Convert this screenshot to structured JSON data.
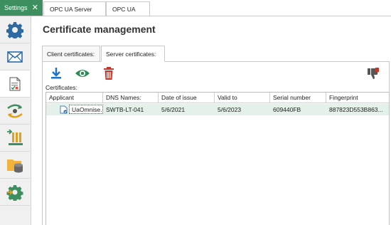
{
  "window_tabs": [
    {
      "label": "Settings",
      "close": "✕"
    },
    {
      "label": "OPC UA Server"
    },
    {
      "label": "OPC UA"
    }
  ],
  "sidebar": {
    "items": [
      {
        "icon": "gear-icon"
      },
      {
        "icon": "mail-icon"
      },
      {
        "icon": "certificate-document-icon"
      },
      {
        "icon": "exchange-arrows-icon"
      },
      {
        "icon": "import-bars-icon"
      },
      {
        "icon": "folder-database-icon"
      },
      {
        "icon": "gear-arrows-icon"
      }
    ],
    "active_index": 2
  },
  "page": {
    "title": "Certificate management"
  },
  "subtabs": [
    {
      "label": "Client certificates:"
    },
    {
      "label": "Server certificates:"
    }
  ],
  "active_subtab": 1,
  "toolbar": {
    "icons": [
      "download-icon",
      "view-eye-icon",
      "delete-trash-icon",
      "reject-thumbs-down-icon"
    ]
  },
  "certificates_label": "Certificates:",
  "table": {
    "columns": [
      "Applicant",
      "DNS Names:",
      "Date of issue",
      "Valid to",
      "Serial number",
      "Fingerprint"
    ],
    "rows": [
      {
        "applicant": "UaOmnise...",
        "dns_names": "SWTB-LT-041",
        "date_of_issue": "5/6/2021",
        "valid_to": "5/6/2023",
        "serial_number": "609440FB",
        "fingerprint": "887823D553B863..."
      }
    ]
  },
  "colors": {
    "accent_green": "#3d8f5f",
    "row_highlight": "#e3f1e8",
    "download_blue": "#1e73c8",
    "eye_green": "#2e8b57",
    "trash_red": "#c0392b"
  }
}
